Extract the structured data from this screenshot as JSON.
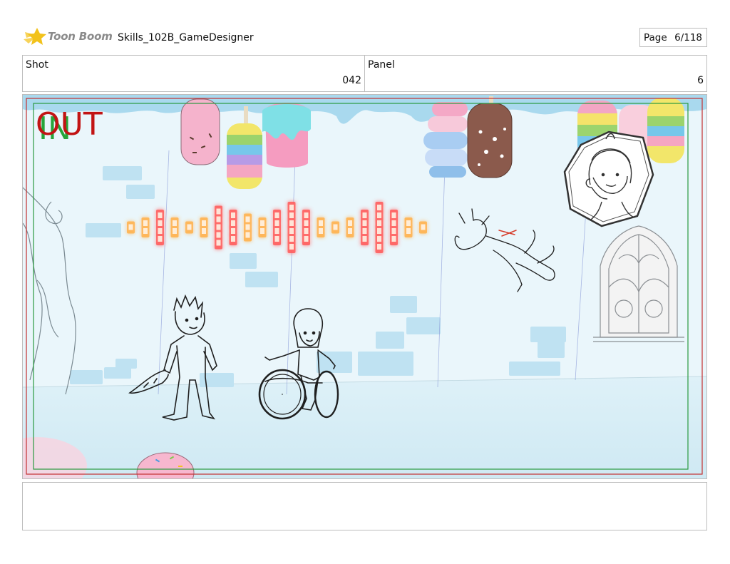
{
  "header": {
    "logo_text": "Toon Boom",
    "doc_title": "Skills_102B_GameDesigner",
    "page_label": "Page",
    "page_value": "6/118"
  },
  "info": {
    "shot_label": "Shot",
    "shot_value": "042",
    "panel_label": "Panel",
    "panel_value": "6"
  },
  "frame": {
    "in_label": "IN",
    "out_label": "OUT"
  },
  "colors": {
    "in_marker": "#27a53a",
    "out_marker": "#c21414",
    "logo_star": "#f2c21b",
    "background_sky": "#eaf6fb",
    "soundwave_hot": "#ff5a5a",
    "soundwave_warm": "#ffb14a"
  },
  "soundwave": {
    "bar_levels": [
      1,
      2,
      4,
      2,
      1,
      2,
      5,
      4,
      3,
      2,
      4,
      6,
      4,
      2,
      1,
      2,
      4,
      6,
      4,
      2,
      1
    ]
  },
  "notes": {
    "text": ""
  }
}
